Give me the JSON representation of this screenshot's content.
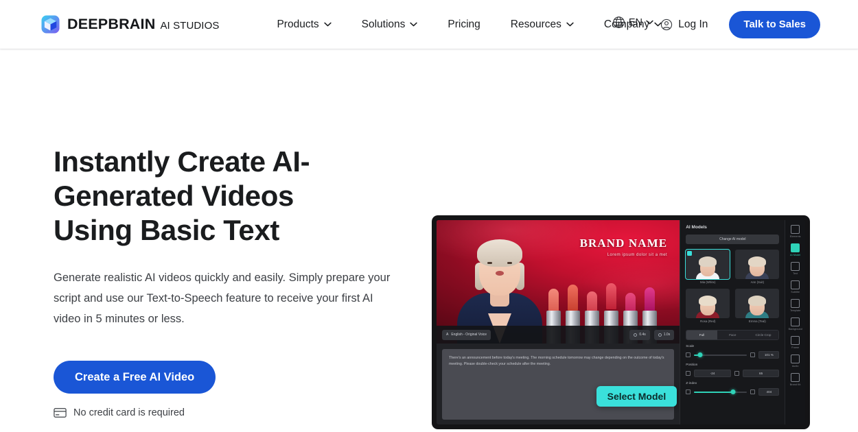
{
  "brand": {
    "logo_icon": "cube-logo-icon",
    "name": "DEEPBRAIN",
    "subtitle": "AI STUDIOS"
  },
  "nav": {
    "items": [
      {
        "label": "Products",
        "has_dropdown": true,
        "icon": "chevron-down-icon"
      },
      {
        "label": "Solutions",
        "has_dropdown": true,
        "icon": "chevron-down-icon"
      },
      {
        "label": "Pricing",
        "has_dropdown": false,
        "icon": ""
      },
      {
        "label": "Resources",
        "has_dropdown": true,
        "icon": "chevron-down-icon"
      },
      {
        "label": "Company",
        "has_dropdown": true,
        "icon": "chevron-down-icon"
      }
    ]
  },
  "header_right": {
    "language": {
      "icon": "globe-icon",
      "label": "EN",
      "chevron": "chevron-down-icon"
    },
    "login": {
      "icon": "user-circle-icon",
      "label": "Log In"
    },
    "cta": {
      "label": "Talk to Sales"
    }
  },
  "hero": {
    "title": "Instantly Create AI-Generated Videos Using Basic Text",
    "subtitle": "Generate realistic AI videos quickly and easily. Simply prepare your script and use our Text-to-Speech feature to receive your first AI video in 5 minutes or less.",
    "cta_label": "Create a Free AI Video",
    "note_icon": "credit-card-icon",
    "note": "No credit card is required"
  },
  "preview": {
    "stage": {
      "brand_title": "BRAND NAME",
      "brand_tagline": "Lorem ipsum dolor sit a met",
      "language_pill": {
        "icon": "translate-icon",
        "label": "English - Original Voice"
      },
      "chips": [
        {
          "icon": "clock-icon",
          "label": "0.4s"
        },
        {
          "icon": "clock-icon",
          "label": "1.0s"
        }
      ]
    },
    "script_text": "There's an announcement before today's meeting. The morning schedule tomorrow may change depending on the outcome of today's meeting. Please double-check your schedule after the meeting.",
    "tooltip_label": "Select Model",
    "panel": {
      "title": "AI Models",
      "change_button": "Change AI model",
      "models": [
        {
          "name": "Mia (White)",
          "selected": true,
          "hair": "#ded3c4",
          "top": "#f2f4f6"
        },
        {
          "name": "Ann (Suit)",
          "selected": false,
          "hair": "#e3d6c5",
          "top": "#3a4157"
        },
        {
          "name": "Rosa (Red)",
          "selected": false,
          "hair": "#e8dcca",
          "top": "#8c1c2a"
        },
        {
          "name": "Emma (Teal)",
          "selected": false,
          "hair": "#ded2c0",
          "top": "#2f7d84"
        }
      ],
      "tabs": [
        {
          "label": "Full",
          "active": true
        },
        {
          "label": "Face",
          "active": false
        },
        {
          "label": "Circle Crop",
          "active": false
        }
      ],
      "controls": {
        "scale": {
          "label": "Scale",
          "value": "101 %",
          "percent": 12
        },
        "position": {
          "label": "Position",
          "x": "-24",
          "y": "65"
        },
        "zindex": {
          "label": "Z-index",
          "value": "404",
          "percent": 74
        }
      }
    },
    "rail": [
      {
        "label": "Elements",
        "icon": "elements-icon",
        "active": false
      },
      {
        "label": "AI Model",
        "icon": "ai-model-icon",
        "active": true
      },
      {
        "label": "Text",
        "icon": "text-icon",
        "active": false
      },
      {
        "label": "Subtitle",
        "icon": "subtitle-icon",
        "active": false
      },
      {
        "label": "Template",
        "icon": "template-icon",
        "active": false
      },
      {
        "label": "Background",
        "icon": "background-icon",
        "active": false
      },
      {
        "label": "Frame",
        "icon": "frame-icon",
        "active": false
      },
      {
        "label": "Audio",
        "icon": "audio-icon",
        "active": false
      },
      {
        "label": "Brand Kit",
        "icon": "brandkit-icon",
        "active": false
      }
    ]
  },
  "colors": {
    "brand_blue": "#1a56d6",
    "accent_teal": "#3ae0db",
    "slider_green": "#2fd3b8",
    "text_dark": "#1a1c1e",
    "text_body": "#3d4045"
  }
}
